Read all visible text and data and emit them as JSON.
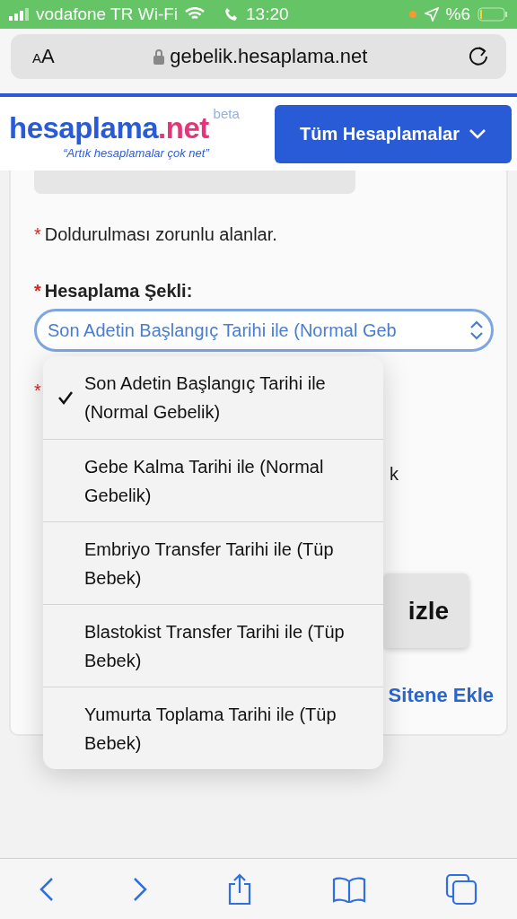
{
  "status_bar": {
    "carrier": "vodafone TR Wi-Fi",
    "time": "13:20",
    "battery": "%6"
  },
  "address_bar": {
    "text_size": "AA",
    "url": "gebelik.hesaplama.net"
  },
  "header": {
    "logo_main": "hesaplama",
    "logo_accent": ".net",
    "logo_badge": "beta",
    "slogan": "“Artık hesaplamalar çok net”",
    "menu_button": "Tüm Hesaplamalar"
  },
  "form": {
    "required_mark": "*",
    "required_note": "Doldurulması zorunlu alanlar.",
    "field_label": "Hesaplama Şekli:",
    "select_value": "Son Adetin Başlangıç Tarihi ile (Normal Geb",
    "second_mark": "*",
    "fragment": "k",
    "button_fragment": "izle",
    "link_fragment": "Sitene Ekle"
  },
  "dropdown": {
    "options": [
      {
        "label": "Son Adetin Başlangıç Tarihi ile (Normal Gebelik)",
        "selected": true
      },
      {
        "label": "Gebe Kalma Tarihi ile (Normal Gebelik)",
        "selected": false
      },
      {
        "label": "Embriyo Transfer Tarihi ile (Tüp Bebek)",
        "selected": false
      },
      {
        "label": "Blastokist Transfer Tarihi ile (Tüp Bebek)",
        "selected": false
      },
      {
        "label": "Yumurta Toplama Tarihi ile (Tüp Bebek)",
        "selected": false
      }
    ]
  }
}
